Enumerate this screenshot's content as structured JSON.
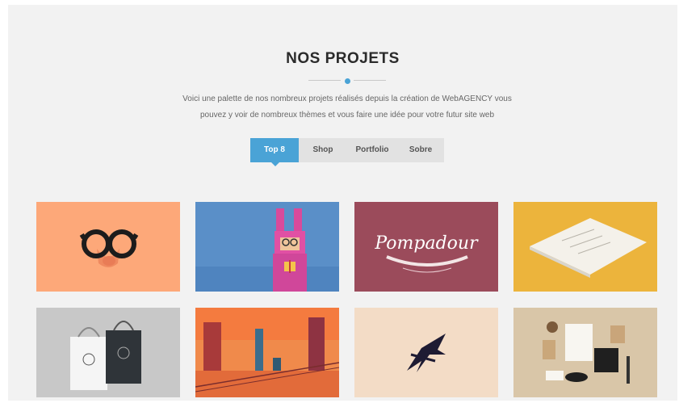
{
  "section": {
    "title": "NOS PROJETS",
    "description_line1": "Voici une palette de nos nombreux projets réalisés depuis la création de WebAGENCY vous",
    "description_line2": "pouvez y voir de nombreux thèmes et vous faire une idée pour votre futur site web"
  },
  "tabs": [
    {
      "label": "Top 8",
      "active": true
    },
    {
      "label": "Shop",
      "active": false
    },
    {
      "label": "Portfolio",
      "active": false
    },
    {
      "label": "Sobre",
      "active": false
    }
  ],
  "projects": [
    {
      "icon": "glasses-nose-illustration",
      "bg": "#fda879"
    },
    {
      "icon": "pink-bunny-character-illustration",
      "bg": "#5a8fc8"
    },
    {
      "icon": "pompadour-logo",
      "bg": "#9b4b5b",
      "logo_text": "Pompadour"
    },
    {
      "icon": "stationery-paper-mockup",
      "bg": "#ecb43c"
    },
    {
      "icon": "shopping-bags-mockup",
      "bg": "#c8c8c8"
    },
    {
      "icon": "city-sunset-illustration",
      "bg": "#f08a4b"
    },
    {
      "icon": "bird-logo",
      "bg": "#f3dcc6"
    },
    {
      "icon": "branding-stationery-flatlay",
      "bg": "#d9c6a8"
    }
  ],
  "colors": {
    "accent": "#4aa3d6",
    "section_bg": "#f2f2f2",
    "tab_bg": "#e2e2e2"
  }
}
